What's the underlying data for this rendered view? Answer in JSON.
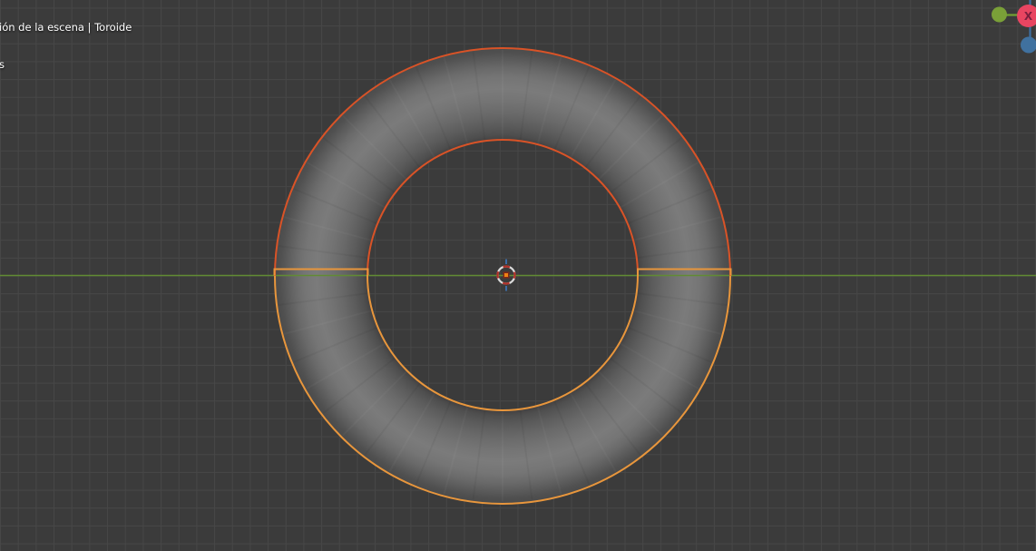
{
  "overlay": {
    "line1": "ión de la escena | Toroide",
    "line2": "s"
  },
  "gizmo": {
    "x_label": "X",
    "colors": {
      "x_ball": "#e84561",
      "x_letter": "#7b1f3e",
      "y_ball": "#7aa038",
      "y_ball_rim": "#8eb83e",
      "y_line": "#72a033",
      "z_ball": "#40719f",
      "z_ball_rim": "#5187bf",
      "z_line": "#3e70a2"
    }
  },
  "scene": {
    "object_name": "Toroide",
    "outline_top": "#d95327",
    "outline_bottom": "#e8963c",
    "equator_edge": "#e8963c",
    "y_axis_color": "#618b33",
    "cursor_red": "#b23028",
    "cursor_white": "#dadada",
    "cursor_tick_blue": "#3d6ca6",
    "origin_ring": "#7e2817",
    "origin_dot": "#ef8214",
    "background": "#3b3b3b",
    "grid_color": "#474747"
  }
}
